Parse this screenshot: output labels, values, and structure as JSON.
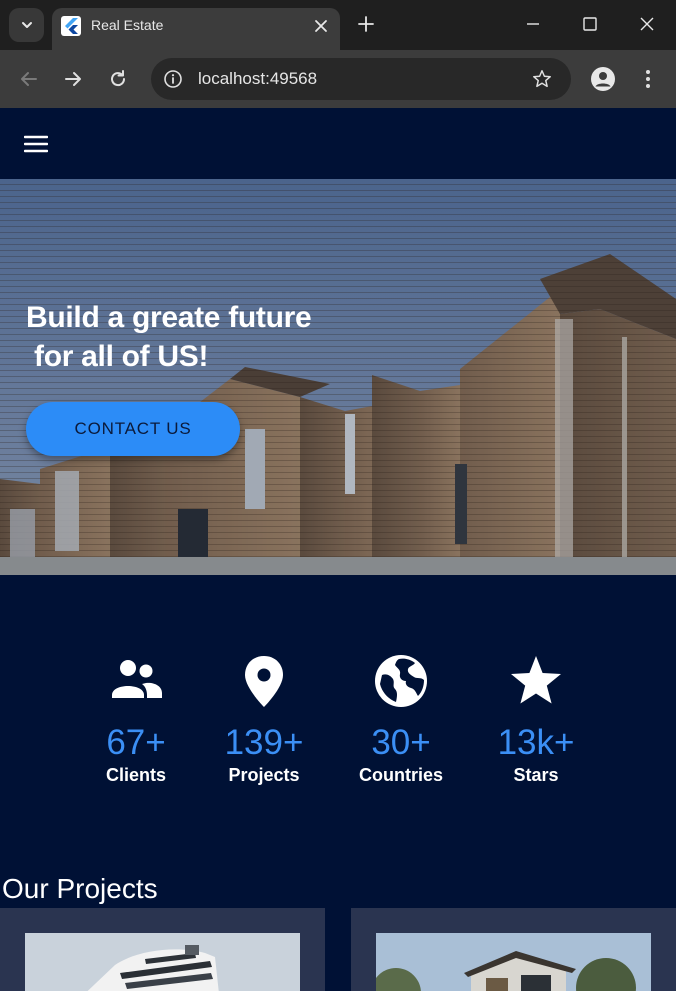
{
  "browser": {
    "tab_title": "Real Estate",
    "url": "localhost:49568"
  },
  "hero": {
    "title": "Build a greate future\n for all of US!",
    "cta_label": "CONTACT US"
  },
  "stats": [
    {
      "icon": "people-icon",
      "value": "67+",
      "label": "Clients"
    },
    {
      "icon": "location-pin-icon",
      "value": "139+",
      "label": "Projects"
    },
    {
      "icon": "globe-icon",
      "value": "30+",
      "label": "Countries"
    },
    {
      "icon": "star-icon",
      "value": "13k+",
      "label": "Stars"
    }
  ],
  "projects": {
    "title": "Our Projects"
  },
  "colors": {
    "background": "#001135",
    "accent": "#2c8cf7",
    "stat_value": "#3b8ff5",
    "card": "#2a3450"
  }
}
